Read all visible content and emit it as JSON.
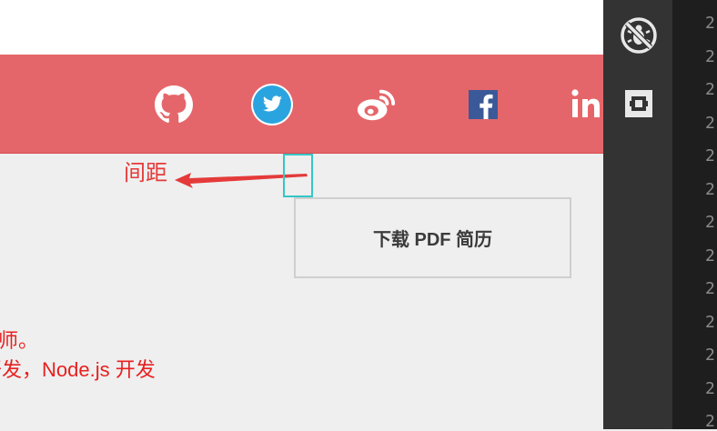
{
  "annotation": {
    "text": "间距"
  },
  "pdf_button": {
    "label": "下载 PDF 简历"
  },
  "bio": {
    "line1": "程师。",
    "line2": "开发，Node.js 开发"
  },
  "social_icons": [
    "github-icon",
    "twitter-icon",
    "weibo-icon",
    "facebook-icon",
    "linkedin-icon"
  ],
  "devtools_icons": [
    "bug-disabled-icon",
    "select-element-icon"
  ],
  "gutter_line_numbers": [
    "2",
    "2",
    "2",
    "2",
    "2",
    "2",
    "2",
    "2",
    "2",
    "2",
    "2",
    "2",
    "2"
  ],
  "colors": {
    "banner": "#e5666a",
    "twitter": "#2aa4df",
    "facebook": "#3b5998",
    "annotation": "#e53a3a",
    "highlight": "#34c7c7"
  }
}
